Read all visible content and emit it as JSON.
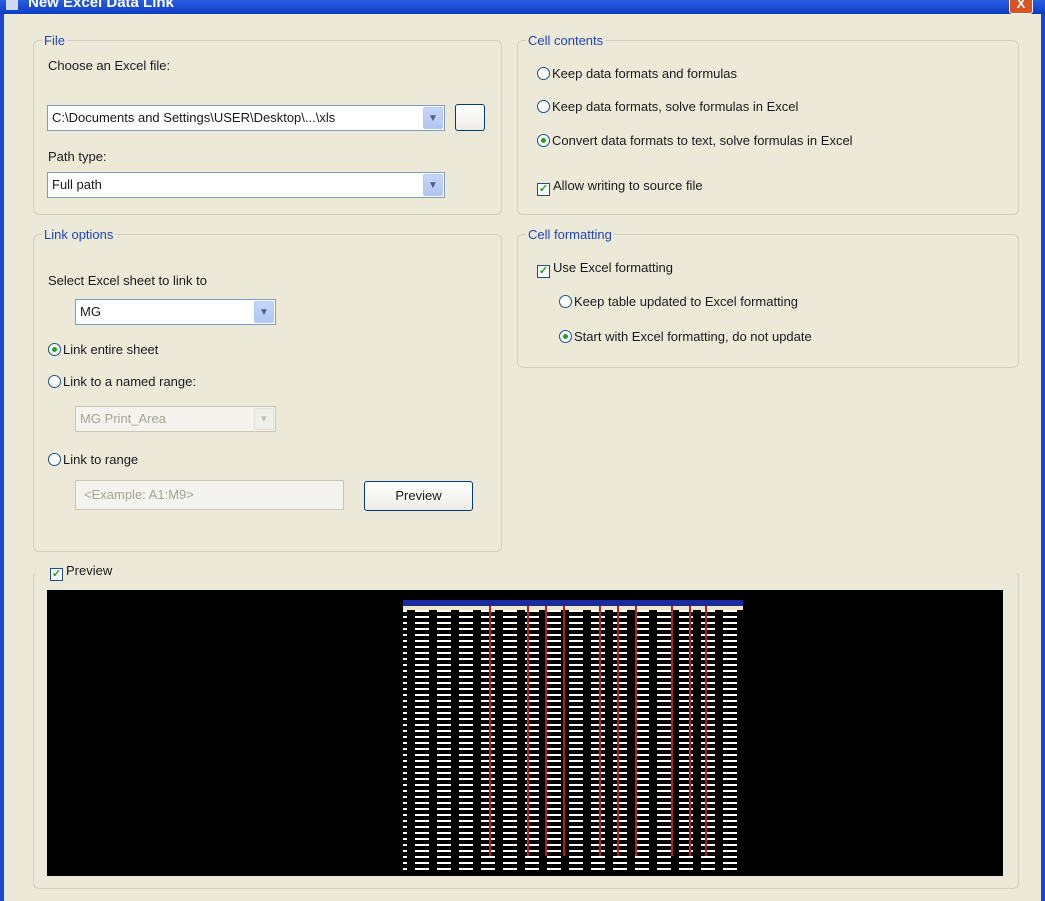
{
  "window": {
    "title": "New Excel Data Link",
    "close_glyph": "X"
  },
  "file_group": {
    "legend": "File",
    "choose_label": "Choose an Excel file:",
    "file_path": "C:\\Documents and Settings\\USER\\Desktop\\...\\xls",
    "path_type_label": "Path type:",
    "path_type_value": "Full path"
  },
  "link_options": {
    "legend": "Link options",
    "select_sheet_label": "Select Excel sheet to link to",
    "sheet_value": "MG",
    "option_entire_sheet": "Link entire sheet",
    "option_named_range": "Link to a named range:",
    "named_range_value": "MG Print_Area",
    "option_range": "Link to range",
    "range_placeholder": "<Example: A1:M9>",
    "preview_button": "Preview"
  },
  "cell_contents": {
    "legend": "Cell contents",
    "option_keep_formats": "Keep data formats and formulas",
    "option_keep_data": "Keep data formats, solve formulas in Excel",
    "option_convert": "Convert data formats to text, solve formulas in Excel",
    "allow_writing": "Allow writing to source file"
  },
  "cell_formatting": {
    "legend": "Cell formatting",
    "use_excel_formatting": "Use Excel formatting",
    "option_keep_updated": "Keep table updated to Excel formatting",
    "option_start_with": "Start with Excel formatting, do not update"
  },
  "preview": {
    "label": "Preview",
    "checked": true
  },
  "icons": {
    "dropdown": "chevron-down-icon",
    "check": "checkmark-icon"
  },
  "colors": {
    "dialog_bg": "#ece9d8",
    "legend_text": "#1e45b8",
    "titlebar": "#0a3bc6",
    "radio_dot": "#21a121",
    "preview_bg": "#000000"
  }
}
